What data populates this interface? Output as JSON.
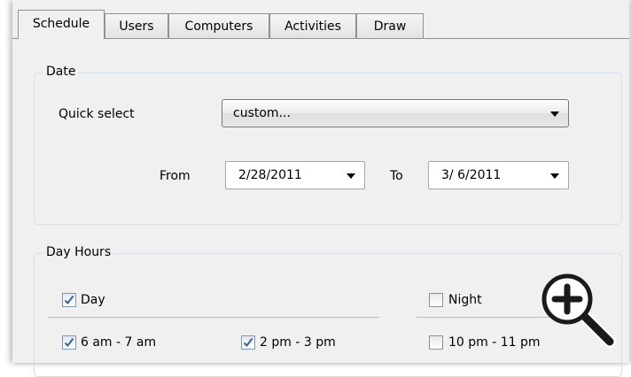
{
  "tabs": [
    {
      "label": "Schedule",
      "active": true
    },
    {
      "label": "Users",
      "active": false
    },
    {
      "label": "Computers",
      "active": false
    },
    {
      "label": "Activities",
      "active": false
    },
    {
      "label": "Draw",
      "active": false
    }
  ],
  "date_group": {
    "legend": "Date",
    "quick_select_label": "Quick select",
    "quick_select_value": "custom...",
    "from_label": "From",
    "from_value": "2/28/2011",
    "to_label": "To",
    "to_value": "3/ 6/2011"
  },
  "day_hours": {
    "legend": "Day Hours",
    "day_label": "Day",
    "day_checked": true,
    "night_label": "Night",
    "night_checked": false,
    "slots": [
      {
        "label": "6 am - 7 am",
        "checked": true
      },
      {
        "label": "2 pm - 3 pm",
        "checked": true
      },
      {
        "label": "10 pm - 11 pm",
        "checked": false
      }
    ]
  },
  "icons": {
    "zoom": "zoom-in-magnifier-icon",
    "dropdown": "chevron-down-icon",
    "check": "check-icon"
  },
  "colors": {
    "panel": "#f0f0f0",
    "group_border": "#d5dfe5",
    "check_mark": "#3a5f9c"
  }
}
